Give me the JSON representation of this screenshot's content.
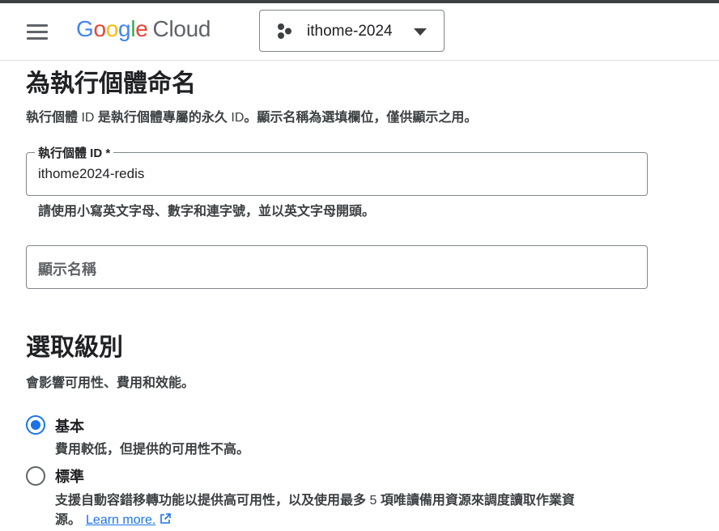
{
  "header": {
    "logo": {
      "G": "G",
      "o1": "o",
      "o2": "o",
      "g": "g",
      "l": "l",
      "e": "e",
      "cloud": "Cloud"
    },
    "project_name": "ithome-2024",
    "icons": {
      "menu": "hamburger-menu-icon",
      "project": "project-hexagons-icon",
      "dropdown": "caret-down-icon"
    }
  },
  "naming": {
    "title": "為執行個體命名",
    "description_part1": "執行個體",
    "description_id1": " ID ",
    "description_part2": "是執行個體專屬的永久",
    "description_id2": " ID",
    "description_part3": "。顯示名稱為選填欄位，僅供顯示之用。",
    "instance_id_label": "執行個體 ID *",
    "instance_id_value": "ithome2024-redis",
    "instance_id_hint": "請使用小寫英文字母、數字和連字號，並以英文字母開頭。",
    "display_name_placeholder": "顯示名稱"
  },
  "tier": {
    "title": "選取級別",
    "description": "會影響可用性、費用和效能。",
    "options": [
      {
        "label": "基本",
        "description": "費用較低，但提供的可用性不高。",
        "selected": true
      },
      {
        "label": "標準",
        "description_line1_a": "支援自動容錯移轉功能以提供高可用性，以及使用最多",
        "description_line1_num": " 5 ",
        "description_line1_b": "項唯讀備用資源來調度讀取作業資",
        "description_line2": "源。",
        "link_text": "Learn more.",
        "selected": false
      }
    ]
  },
  "colors": {
    "accent": "#1a73e8",
    "border": "#80868b",
    "text": "#202124"
  }
}
